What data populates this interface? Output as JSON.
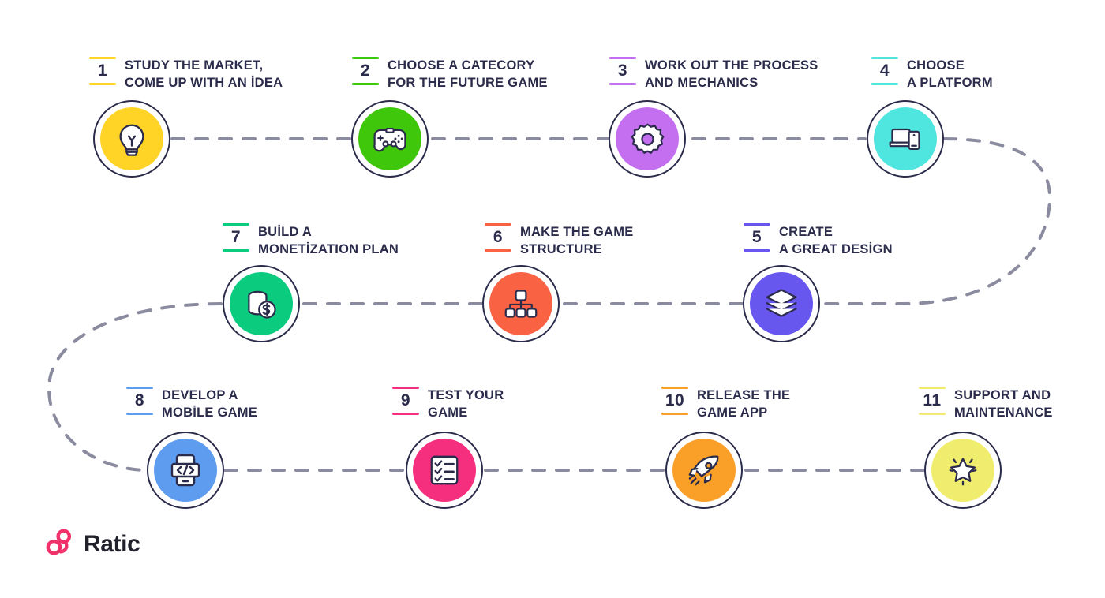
{
  "brand": {
    "name": "Ratic",
    "logo_icon": "trefoil-rings-icon",
    "logo_color": "#f0326b",
    "text_color": "#21212b"
  },
  "theme": {
    "background": "#ffffff",
    "text_color": "#2b2b4b",
    "outline_color": "#2b2b4b",
    "connector_color": "#8b8ba0",
    "connector_style": "dashed"
  },
  "steps": [
    {
      "number": "1",
      "title": "STUDY THE MARKET,\nCOME UP WITH AN İDEA",
      "color": "#ffd426",
      "icon": "lightbulb-icon",
      "row": 1
    },
    {
      "number": "2",
      "title": "CHOOSE A CATECORY\nFOR THE FUTURE GAME",
      "color": "#3ec70b",
      "icon": "gamepad-icon",
      "row": 1
    },
    {
      "number": "3",
      "title": "WORK OUT THE PROCESS\nAND MECHANICS",
      "color": "#c46ef0",
      "icon": "gear-icon",
      "row": 1
    },
    {
      "number": "4",
      "title": "CHOOSE\nA PLATFORM",
      "color": "#4fe6e0",
      "icon": "laptop-phone-icon",
      "row": 1
    },
    {
      "number": "5",
      "title": "CREATE\nA GREAT DESİGN",
      "color": "#6757ee",
      "icon": "layers-icon",
      "row": 2
    },
    {
      "number": "6",
      "title": "MAKE THE GAME\nSTRUCTURE",
      "color": "#fa6244",
      "icon": "hierarchy-icon",
      "row": 2
    },
    {
      "number": "7",
      "title": "BUİLD A\nMONETİZATION PLAN",
      "color": "#0bcb7f",
      "icon": "coins-dollar-icon",
      "row": 2
    },
    {
      "number": "8",
      "title": "DEVELOP A\nMOBİLE GAME",
      "color": "#5e9cf0",
      "icon": "mobile-code-icon",
      "row": 3
    },
    {
      "number": "9",
      "title": "TEST YOUR\nGAME",
      "color": "#f52f7e",
      "icon": "checklist-icon",
      "row": 3
    },
    {
      "number": "10",
      "title": "RELEASE THE\nGAME APP",
      "color": "#faa028",
      "icon": "rocket-icon",
      "row": 3
    },
    {
      "number": "11",
      "title": "SUPPORT AND\nMAINTENANCE",
      "color": "#f0ed6e",
      "icon": "star-sparkle-icon",
      "row": 3
    }
  ]
}
